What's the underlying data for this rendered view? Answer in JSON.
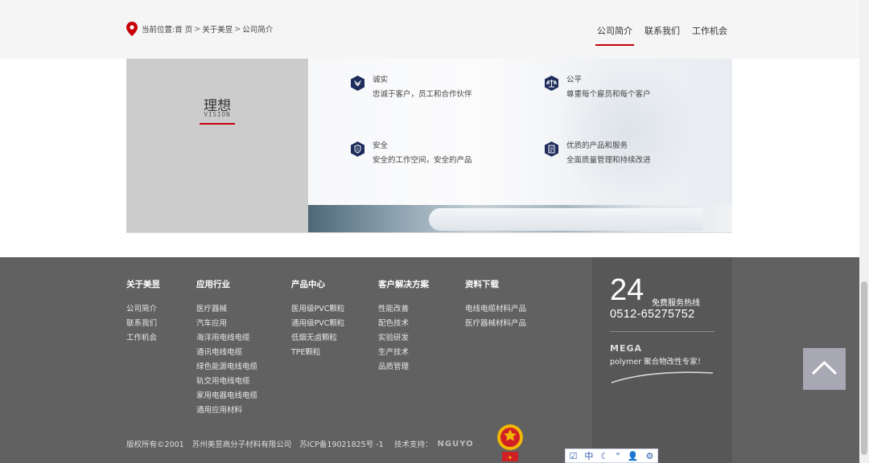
{
  "breadcrumb": {
    "prefix": "当前位置:",
    "items": [
      "首 页",
      "关于美昱",
      "公司简介"
    ],
    "separator": ">"
  },
  "subnav": {
    "items": [
      "公司简介",
      "联系我们",
      "工作机会"
    ],
    "active": 0
  },
  "vision": {
    "title": "理想",
    "subtitle": "VISION",
    "values": [
      {
        "title": "诚实",
        "desc": "忠诚于客户，员工和合作伙伴",
        "icon": "handshake-icon"
      },
      {
        "title": "公平",
        "desc": "尊重每个雇员和每个客户",
        "icon": "scales-icon"
      },
      {
        "title": "安全",
        "desc": "安全的工作空间，安全的产品",
        "icon": "shield-icon"
      },
      {
        "title": "优质的产品和服务",
        "desc": "全面质量管理和持续改进",
        "icon": "quality-icon"
      }
    ],
    "badge_color": "#1f2d5c"
  },
  "footer": {
    "columns": [
      {
        "heading": "关于美昱",
        "links": [
          "公司简介",
          "联系我们",
          "工作机会"
        ]
      },
      {
        "heading": "应用行业",
        "links": [
          "医疗器械",
          "汽车应用",
          "海洋用电线电缆",
          "通讯电线电缆",
          "绿色能源电线电缆",
          "轨交用电线电缆",
          "家用电器电线电缆",
          "通用应用材料"
        ]
      },
      {
        "heading": "产品中心",
        "links": [
          "医用级PVC颗粒",
          "通用级PVC颗粒",
          "低烟无卤颗粒",
          "TPE颗粒"
        ]
      },
      {
        "heading": "客户解决方案",
        "links": [
          "性能改善",
          "配色技术",
          "实验研发",
          "生产技术",
          "品质管理"
        ]
      },
      {
        "heading": "资料下载",
        "links": [
          "电线电缆材料产品",
          "医疗器械材料产品"
        ]
      }
    ],
    "hotline": {
      "number": "24",
      "label": "免费服务热线",
      "phone": "0512-65275752",
      "brand": "MEGA",
      "tagline": "polymer 聚合物改性专家！"
    },
    "copyright": [
      "版权所有©2001",
      "苏州美昱高分子材料有限公司",
      "苏ICP备19021825号 -1"
    ],
    "tech_support_label": "技术支持：",
    "tech_support_logo": "NGUYO"
  },
  "ime": {
    "items": [
      "中"
    ]
  },
  "colors": {
    "accent": "#c7000b",
    "footer_bg": "#616161",
    "hotline_bg": "#575757",
    "to_top_bg": "#a8a8b4"
  }
}
